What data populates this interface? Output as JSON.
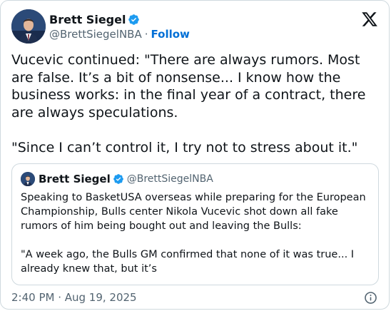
{
  "author": {
    "display_name": "Brett Siegel",
    "handle": "@BrettSiegelNBA",
    "separator": "·",
    "follow_label": "Follow"
  },
  "tweet": {
    "text": "Vucevic continued: \"There are always rumors. Most are false. It’s a bit of nonsense... I know how the business works: in the final year of a contract, there are always speculations.\n\n\"Since I can’t control it, I try not to stress about it.\"",
    "timestamp": "2:40 PM · Aug 19, 2025"
  },
  "quoted_tweet": {
    "display_name": "Brett Siegel",
    "handle": "@BrettSiegelNBA",
    "text": "Speaking to BasketUSA overseas while preparing for the European Championship, Bulls center Nikola Vucevic shot down all fake rumors of him being bought out and leaving the Bulls:\n\n\"A week ago, the Bulls GM confirmed that none of it was true... I already knew that, but it’s"
  },
  "icons": {
    "verified": "verified-badge-icon",
    "platform": "x-logo-icon",
    "info": "info-icon"
  },
  "colors": {
    "verified_blue": "#1d9bf0",
    "link_blue": "#006fd6",
    "secondary_text": "#536471",
    "border": "#cfd9de"
  }
}
